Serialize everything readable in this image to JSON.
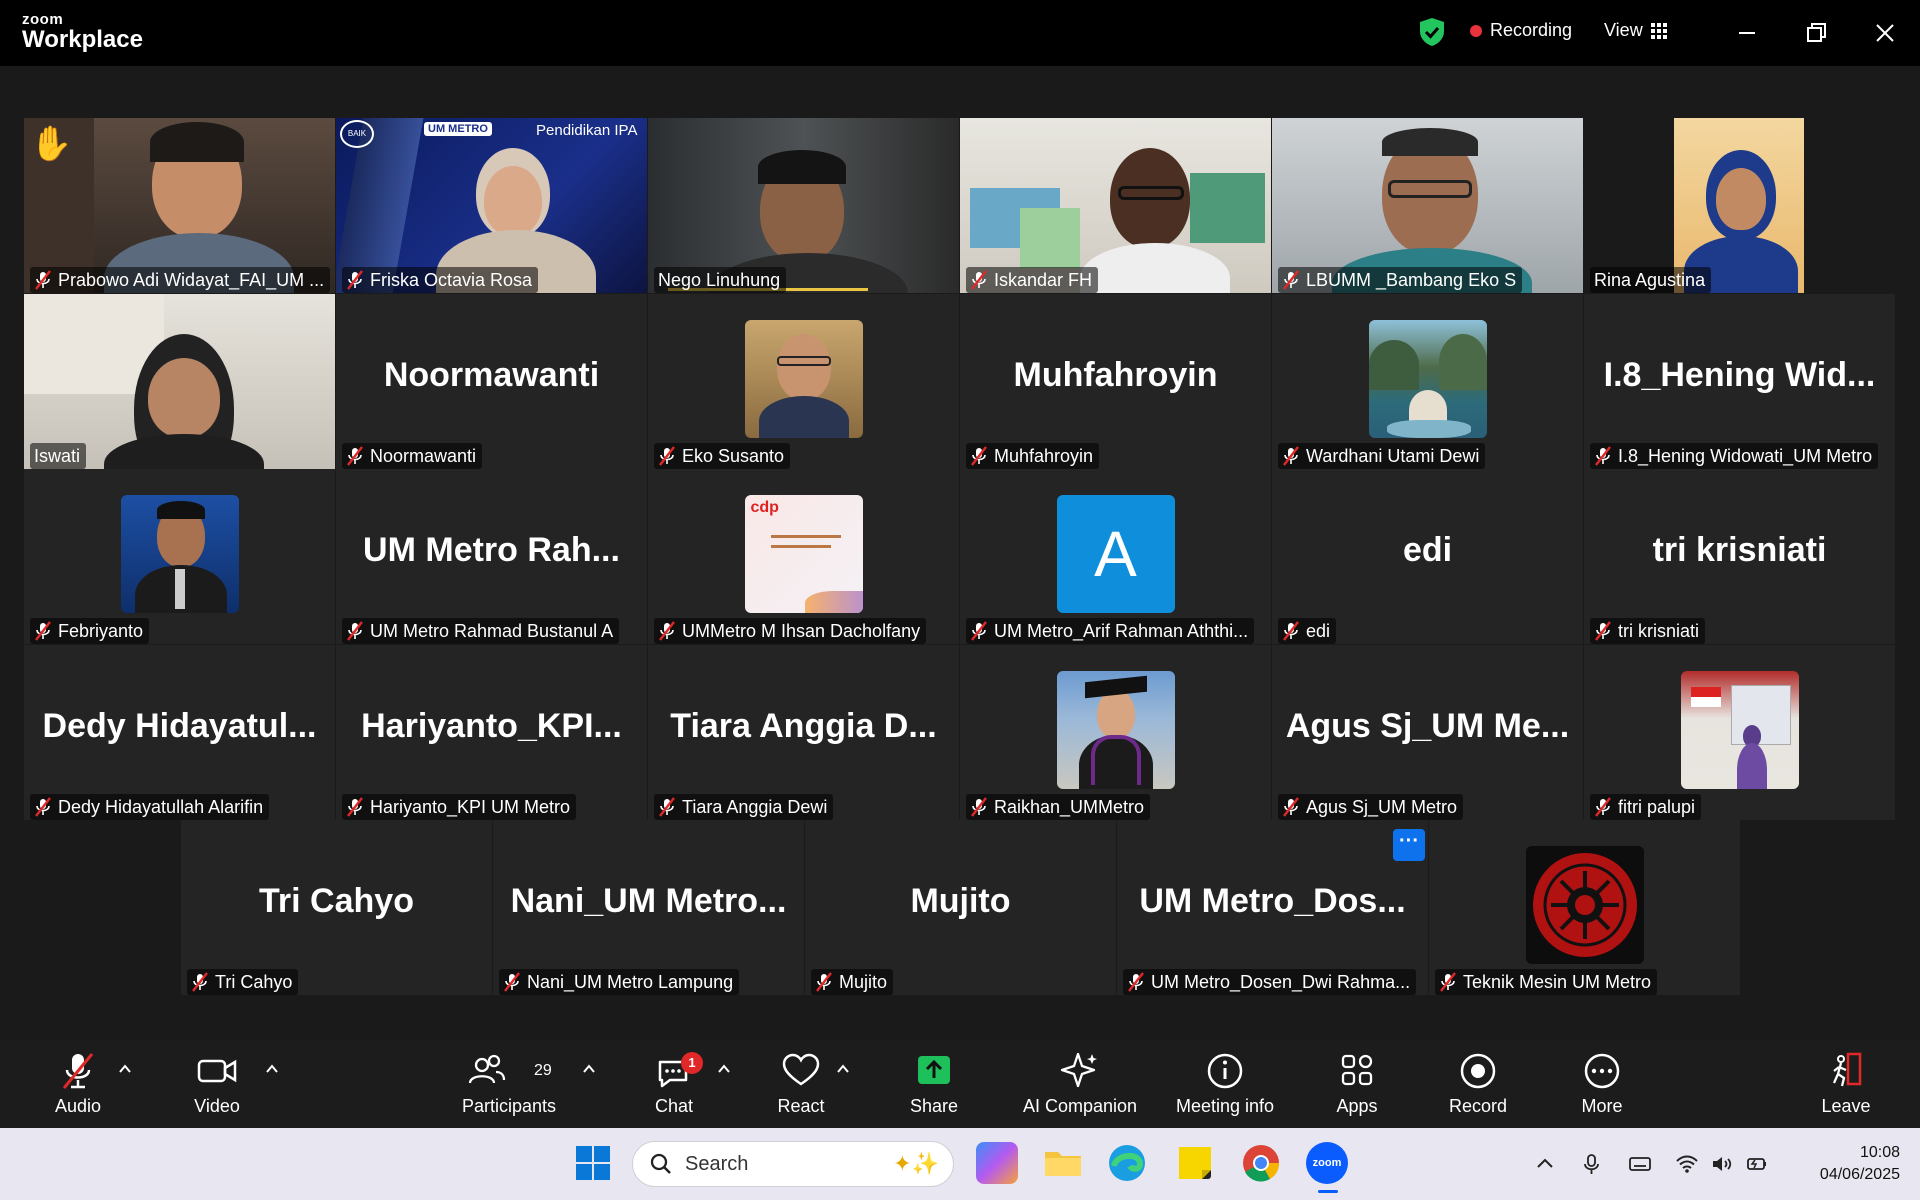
{
  "titlebar": {
    "logo_small": "zoom",
    "logo_big": "Workplace",
    "recording_label": "Recording",
    "view_label": "View"
  },
  "participants": [
    {
      "name": "Prabowo Adi Widayat_FAI_UM ...",
      "display": "",
      "muted": true,
      "kind": "video"
    },
    {
      "name": "Friska Octavia Rosa",
      "display": "",
      "muted": true,
      "kind": "video"
    },
    {
      "name": "Nego Linuhung",
      "display": "",
      "muted": false,
      "kind": "video"
    },
    {
      "name": "Iskandar FH",
      "display": "",
      "muted": true,
      "kind": "video"
    },
    {
      "name": "LBUMM _Bambang Eko S",
      "display": "",
      "muted": true,
      "kind": "video"
    },
    {
      "name": "Rina Agustina",
      "display": "",
      "muted": false,
      "kind": "video",
      "active": true
    },
    {
      "name": "Iswati",
      "display": "",
      "muted": false,
      "kind": "video"
    },
    {
      "name": "Noormawanti",
      "display": "Noormawanti",
      "muted": true,
      "kind": "text"
    },
    {
      "name": "Eko Susanto",
      "display": "",
      "muted": true,
      "kind": "photo"
    },
    {
      "name": "Muhfahroyin",
      "display": "Muhfahroyin",
      "muted": true,
      "kind": "text"
    },
    {
      "name": "Wardhani Utami Dewi",
      "display": "",
      "muted": true,
      "kind": "photo"
    },
    {
      "name": "I.8_Hening Widowati_UM Metro",
      "display": "I.8_Hening  Wid...",
      "muted": true,
      "kind": "text"
    },
    {
      "name": "Febriyanto",
      "display": "",
      "muted": true,
      "kind": "photo"
    },
    {
      "name": "UM Metro Rahmad Bustanul A",
      "display": "UM  Metro  Rah...",
      "muted": true,
      "kind": "text"
    },
    {
      "name": "UMMetro M Ihsan Dacholfany",
      "display": "",
      "muted": true,
      "kind": "photo"
    },
    {
      "name": "UM Metro_Arif Rahman Aththi...",
      "display": "A",
      "muted": true,
      "kind": "letter"
    },
    {
      "name": "edi",
      "display": "edi",
      "muted": true,
      "kind": "text"
    },
    {
      "name": "tri krisniati",
      "display": "tri krisniati",
      "muted": true,
      "kind": "text"
    },
    {
      "name": "Dedy Hidayatullah Alarifin",
      "display": "Dedy  Hidayatul...",
      "muted": true,
      "kind": "text"
    },
    {
      "name": "Hariyanto_KPI UM Metro",
      "display": "Hariyanto_KPI...",
      "muted": true,
      "kind": "text"
    },
    {
      "name": "Tiara Anggia Dewi",
      "display": "Tiara  Anggia  D...",
      "muted": true,
      "kind": "text"
    },
    {
      "name": "Raikhan_UMMetro",
      "display": "",
      "muted": true,
      "kind": "photo"
    },
    {
      "name": "Agus Sj_UM Metro",
      "display": "Agus  Sj_UM  Me...",
      "muted": true,
      "kind": "text"
    },
    {
      "name": "fitri palupi",
      "display": "",
      "muted": true,
      "kind": "photo"
    },
    {
      "name": "Tri Cahyo",
      "display": "Tri Cahyo",
      "muted": true,
      "kind": "text"
    },
    {
      "name": "Nani_UM Metro Lampung",
      "display": "Nani_UM  Metro...",
      "muted": true,
      "kind": "text"
    },
    {
      "name": "Mujito",
      "display": "Mujito",
      "muted": true,
      "kind": "text"
    },
    {
      "name": "UM Metro_Dosen_Dwi Rahma...",
      "display": "UM  Metro_Dos...",
      "muted": true,
      "kind": "text"
    },
    {
      "name": "Teknik Mesin UM Metro",
      "display": "",
      "muted": true,
      "kind": "photo"
    }
  ],
  "video_overlays": {
    "friska_banner": "Pendidikan IPA",
    "friska_logo": "UM METRO",
    "friska_badge": "BAIK"
  },
  "more_button": "···",
  "toolbar": {
    "audio": "Audio",
    "video": "Video",
    "participants": "Participants",
    "participants_count": "29",
    "chat": "Chat",
    "chat_badge": "1",
    "react": "React",
    "share": "Share",
    "ai_companion": "AI Companion",
    "meeting_info": "Meeting info",
    "apps": "Apps",
    "record": "Record",
    "more": "More",
    "leave": "Leave"
  },
  "taskbar": {
    "search_placeholder": "Search",
    "zoom_label": "zoom",
    "time": "10:08",
    "date": "04/06/2025"
  },
  "colors": {
    "accent_green": "#2ee58a",
    "recording_red": "#e8323c",
    "zoom_blue": "#0e72ed",
    "muted_red": "#e02828"
  }
}
